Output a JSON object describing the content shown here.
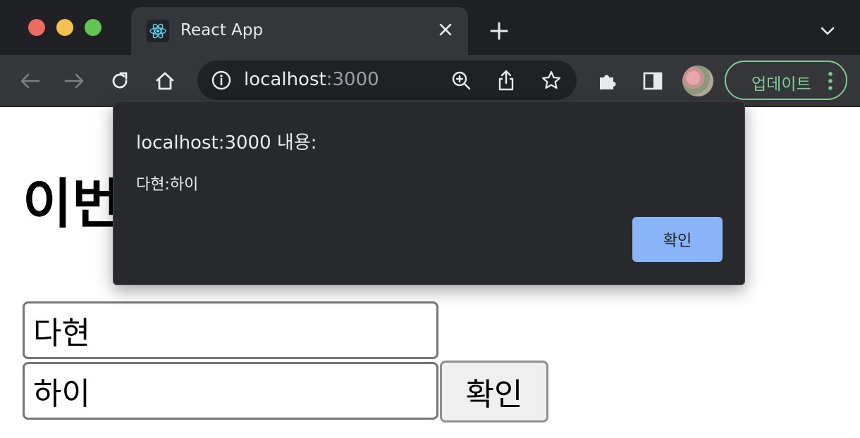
{
  "browser": {
    "tab": {
      "title": "React App"
    },
    "address": {
      "host": "localhost",
      "port": ":3000"
    },
    "update_button": {
      "label": "업데이트"
    }
  },
  "page": {
    "heading": "이번",
    "name_input": {
      "value": "다현"
    },
    "message_input": {
      "value": "하이"
    },
    "submit_button": {
      "label": "확인"
    }
  },
  "alert": {
    "title": "localhost:3000 내용:",
    "message": "다현:하이",
    "ok_label": "확인"
  },
  "colors": {
    "update_green": "#81c995",
    "dialog_button": "#8ab4f8",
    "dialog_bg": "#28292c"
  }
}
